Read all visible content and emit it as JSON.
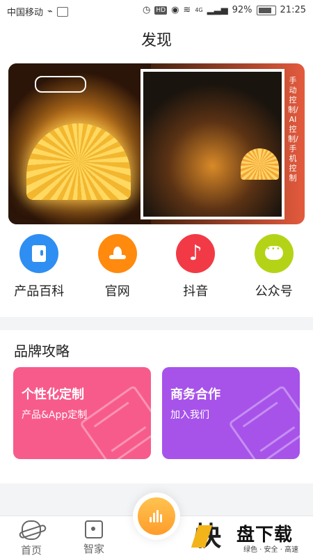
{
  "status_bar": {
    "carrier": "中国移动",
    "battery": "92%",
    "time": "21:25",
    "hd": "HD",
    "network": "4G"
  },
  "header": {
    "title": "发现"
  },
  "banner": {
    "vertical_text": "手动控制/AI控制/手机控制",
    "colors": {
      "accent": "#e45a3d"
    }
  },
  "shortcuts": [
    {
      "label": "产品百科",
      "icon": "book-icon",
      "color": "#2f8ef1"
    },
    {
      "label": "官网",
      "icon": "lotus-icon",
      "color": "#ff8a0e"
    },
    {
      "label": "抖音",
      "icon": "tiktok-icon",
      "color": "#f23a46"
    },
    {
      "label": "公众号",
      "icon": "chat-icon",
      "color": "#b4d316"
    }
  ],
  "brand_section": {
    "title": "品牌攻略",
    "cards": [
      {
        "title": "个性化定制",
        "subtitle": "产品&App定制",
        "color": "#f75b8c"
      },
      {
        "title": "商务合作",
        "subtitle": "加入我们",
        "color": "#a753ea"
      }
    ]
  },
  "bottom_nav": {
    "home": "首页",
    "smart_home": "智家"
  },
  "watermark": {
    "name": "盘下载",
    "sub": "绿色 · 安全 · 高速"
  }
}
